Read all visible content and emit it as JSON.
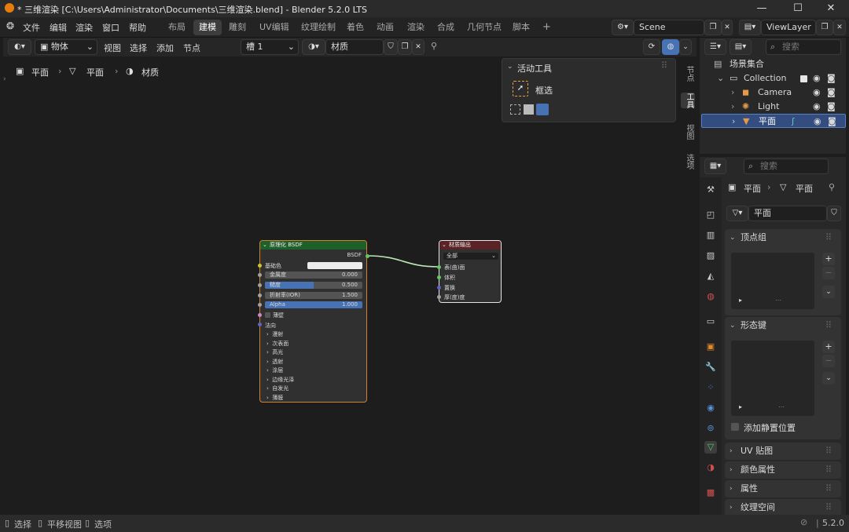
{
  "titlebar": {
    "title": "* 三维渲染 [C:\\Users\\Administrator\\Documents\\三维渲染.blend] - Blender 5.2.0 LTS",
    "minimize": "—",
    "maximize": "☐",
    "close": "✕"
  },
  "menu": {
    "items": [
      "文件",
      "编辑",
      "渲染",
      "窗口",
      "帮助"
    ],
    "workspaces": [
      "布局",
      "建模",
      "雕刻",
      "UV编辑",
      "纹理绘制",
      "着色",
      "动画",
      "渲染",
      "合成",
      "几何节点",
      "脚本"
    ],
    "active_workspace": "建模",
    "add_tab": "+",
    "scene": "Scene",
    "view_layer": "ViewLayer"
  },
  "node_header": {
    "mode": "物体",
    "menus": [
      "视图",
      "选择",
      "添加",
      "节点"
    ],
    "slot": "槽 1",
    "material": "材质"
  },
  "breadcrumb": [
    "平面",
    "平面",
    "材质"
  ],
  "tool_panel": {
    "title": "活动工具",
    "tool": "框选"
  },
  "side_tabs": [
    "节点",
    "工具",
    "视图",
    "选项"
  ],
  "nodes": {
    "bsdf": {
      "title": "原理化 BSDF",
      "output": "BSDF",
      "base_color": "基础色",
      "metallic": {
        "label": "金属度",
        "value": "0.000"
      },
      "roughness": {
        "label": "糙度",
        "value": "0.500"
      },
      "ior": {
        "label": "折射率(IOR)",
        "value": "1.500"
      },
      "alpha": {
        "label": "Alpha",
        "value": "1.000"
      },
      "thin_wall": "薄壁",
      "normal": "法向",
      "sections": [
        "漫射",
        "次表面",
        "高光",
        "透射",
        "涂层",
        "边缘光泽",
        "自发光",
        "薄膜"
      ]
    },
    "output": {
      "title": "材质输出",
      "target": "全部",
      "inputs": [
        "表(曲)面",
        "体积",
        "置换",
        "厚(度)度"
      ]
    }
  },
  "outliner": {
    "search_placeholder": "搜索",
    "scene_collection": "场景集合",
    "items": [
      "Collection",
      "Camera",
      "Light",
      "平面"
    ]
  },
  "properties": {
    "search_placeholder": "搜索",
    "breadcrumb": [
      "平面",
      "平面"
    ],
    "mesh_name": "平面",
    "panels": {
      "vertex_groups": "顶点组",
      "shape_keys": "形态键",
      "add_rest_position": "添加静置位置",
      "uv_maps": "UV 贴图",
      "color_attributes": "颜色属性",
      "attributes": "属性",
      "texture_space": "纹理空间"
    }
  },
  "statusbar": {
    "select": "选择",
    "pan_view": "平移视图",
    "options": "选项",
    "version": "5.2.0"
  },
  "colors": {
    "bsdf_header": "#1f5f2a",
    "output_header": "#5a2326",
    "accent_blue": "#4772b3",
    "selection_blue": "#334d80"
  }
}
